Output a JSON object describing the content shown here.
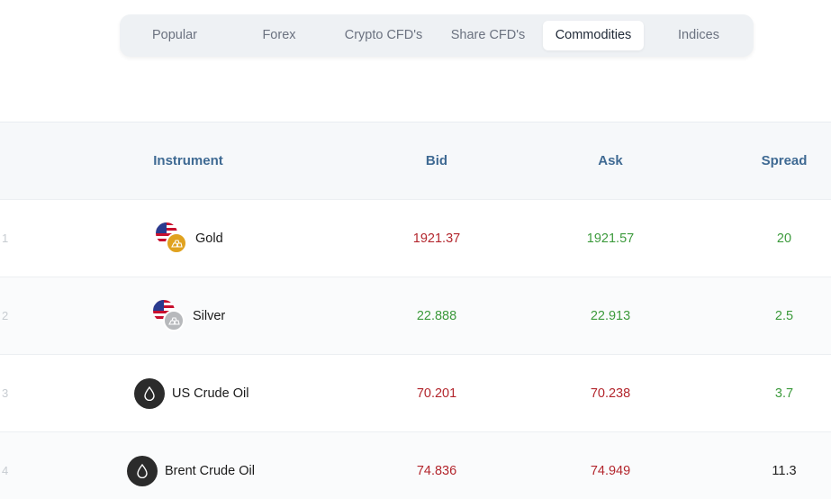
{
  "tabs": [
    {
      "label": "Popular",
      "active": false
    },
    {
      "label": "Forex",
      "active": false
    },
    {
      "label": "Crypto CFD's",
      "active": false
    },
    {
      "label": "Share CFD's",
      "active": false
    },
    {
      "label": "Commodities",
      "active": true
    },
    {
      "label": "Indices",
      "active": false
    }
  ],
  "table": {
    "headers": {
      "instrument": "Instrument",
      "bid": "Bid",
      "ask": "Ask",
      "spread": "Spread"
    },
    "rows": [
      {
        "num": "1",
        "name": "Gold",
        "icon": "gold-bars-icon",
        "bid": "1921.37",
        "ask": "1921.57",
        "spread": "20"
      },
      {
        "num": "2",
        "name": "Silver",
        "icon": "silver-bars-icon",
        "bid": "22.888",
        "ask": "22.913",
        "spread": "2.5"
      },
      {
        "num": "3",
        "name": "US Crude Oil",
        "icon": "oil-drop-icon",
        "bid": "70.201",
        "ask": "70.238",
        "spread": "3.7"
      },
      {
        "num": "4",
        "name": "Brent Crude Oil",
        "icon": "oil-drop-icon",
        "bid": "74.836",
        "ask": "74.949",
        "spread": "11.3"
      }
    ]
  },
  "colors": {
    "down": "#b3262d",
    "up": "#3c9a3c",
    "neutral": "#222222",
    "header": "#3f6a93"
  }
}
